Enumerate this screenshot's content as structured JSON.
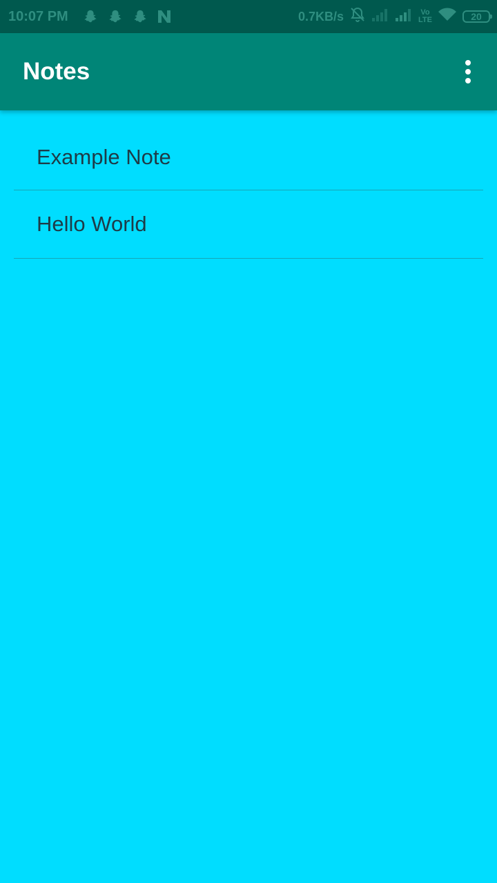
{
  "status_bar": {
    "time": "10:07 PM",
    "left_icons": [
      "snapchat-icon",
      "snapchat-icon",
      "snapchat-icon",
      "n-icon"
    ],
    "network_speed": "0.7KB/s",
    "volte_top": "Vo",
    "volte_bottom": "LTE",
    "battery": "20",
    "icon_color": "#2F8E80",
    "background": "#00594E"
  },
  "app_bar": {
    "title": "Notes",
    "background": "#008577",
    "overflow_icon": "more-vertical-icon"
  },
  "notes": [
    {
      "title": "Example Note"
    },
    {
      "title": "Hello World"
    }
  ],
  "colors": {
    "page_background": "#00DDFF",
    "divider": "#17A6B6",
    "text": "#1E3B47"
  }
}
